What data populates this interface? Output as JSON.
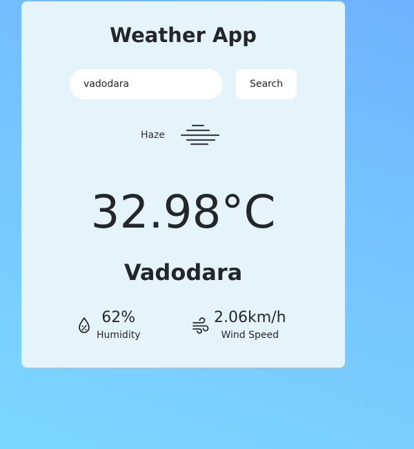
{
  "app": {
    "title": "Weather App"
  },
  "search": {
    "value": "vadodara",
    "button_label": "Search"
  },
  "weather": {
    "condition": "Haze",
    "condition_icon": "haze-icon",
    "temperature": "32.98°C",
    "city": "Vadodara"
  },
  "stats": {
    "humidity": {
      "value": "62%",
      "label": "Humidity",
      "icon": "humidity-drop-icon"
    },
    "wind": {
      "value": "2.06km/h",
      "label": "Wind Speed",
      "icon": "wind-icon"
    }
  },
  "colors": {
    "background_top": "#6fb3fe",
    "background_bottom": "#7bd7fe",
    "card": "#e5f4fa",
    "text": "#23272b"
  }
}
